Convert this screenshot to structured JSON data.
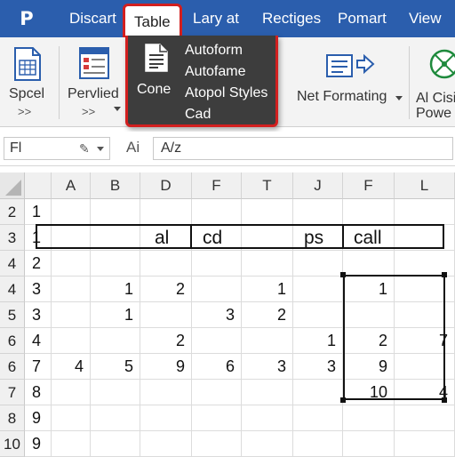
{
  "app_icon": "P",
  "menu": {
    "items": [
      "Discart",
      "Table",
      "Lary at",
      "Rectiges",
      "Pomart",
      "View"
    ],
    "active_index": 1
  },
  "ribbon": {
    "groups": [
      {
        "label": "Spcel",
        "sub": ">>",
        "icon": "document-grid-icon"
      },
      {
        "label": "Pervlied",
        "sub": ">>",
        "icon": "table-form-icon"
      },
      {
        "label": "Net Formating",
        "sub": "",
        "icon": "conditional-format-icon"
      },
      {
        "label": "Al Cisi",
        "sub": "Powe",
        "icon": "ai-network-icon"
      }
    ]
  },
  "dropdown": {
    "left_label": "Cone",
    "items": [
      "Autoform",
      "Autofame",
      "Atopol Styles",
      "Cad"
    ]
  },
  "formula_bar": {
    "name_box": "Fl",
    "fx_label": "Ai",
    "formula": "A/z"
  },
  "grid": {
    "columns": [
      "A",
      "B",
      "D",
      "F",
      "T",
      "J",
      "F",
      "L"
    ],
    "row_headers": [
      "2",
      "3",
      "4",
      "4",
      "5",
      "6",
      "6",
      "7",
      "8",
      "10"
    ],
    "first_col": [
      "1",
      "1",
      "2",
      "3",
      "3",
      "4",
      "7",
      "8",
      "9",
      "9"
    ],
    "merged_row_texts": [
      "al",
      "cd",
      "ps",
      "call"
    ],
    "cells": [
      [],
      [],
      [],
      [
        "",
        "",
        "1",
        "2",
        "",
        "1",
        "",
        "1",
        ""
      ],
      [
        "",
        "",
        "1",
        "",
        "3",
        "2",
        "",
        "",
        ""
      ],
      [
        "",
        "",
        "",
        "2",
        "",
        "",
        "1",
        "2",
        "7"
      ],
      [
        "",
        "4",
        "5",
        "9",
        "6",
        "3",
        "3",
        "9",
        ""
      ],
      [
        "",
        "",
        "",
        "",
        "",
        "",
        "",
        "10",
        "4"
      ],
      [],
      []
    ]
  }
}
